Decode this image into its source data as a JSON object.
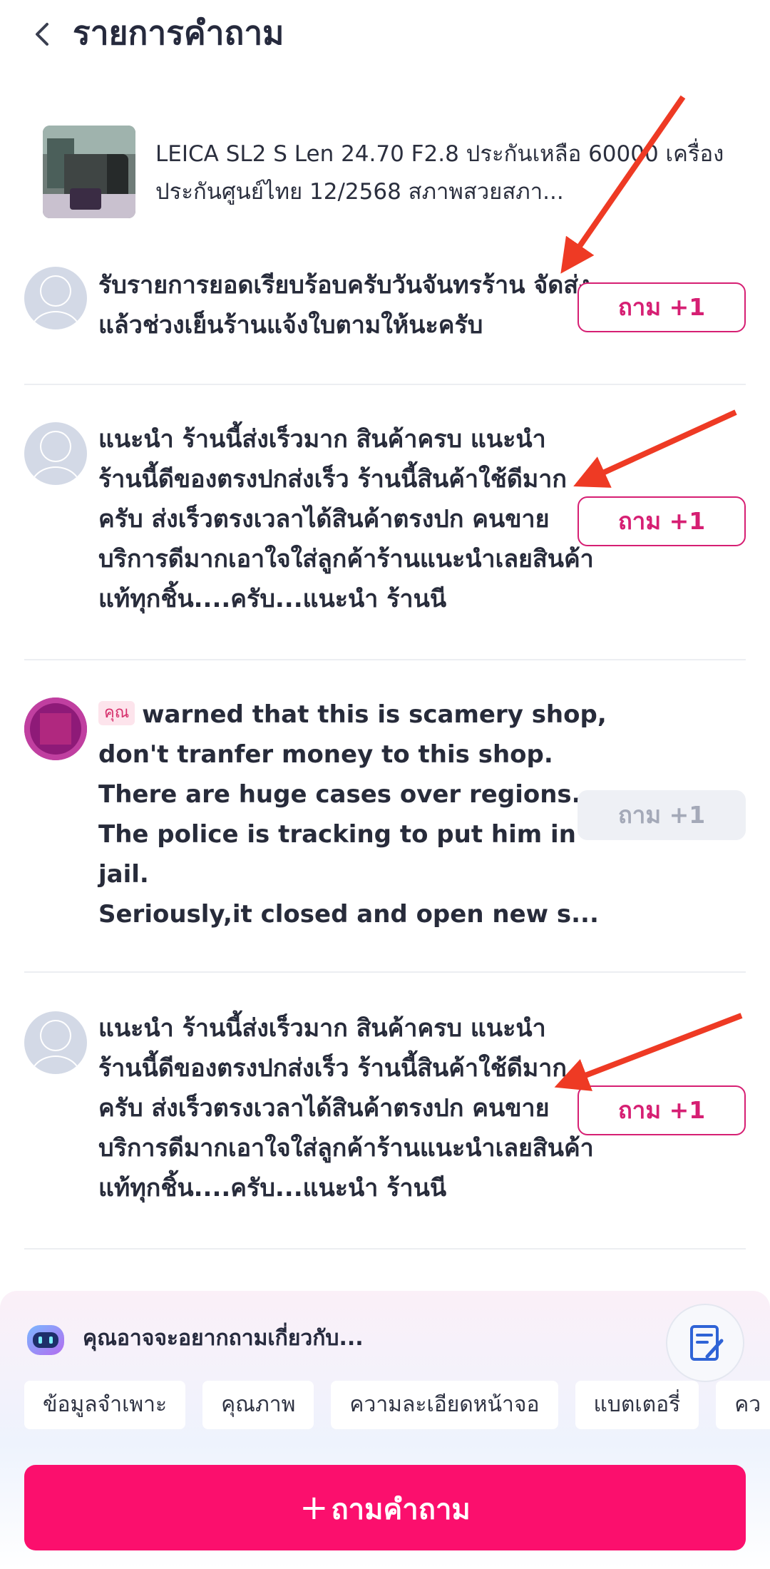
{
  "header": {
    "title": "รายการคำถาม"
  },
  "product": {
    "title": "LEICA SL2 S Len 24.70 F2.8  ประกันเหลือ 60000  เครื่องประกันศูนย์ไทย 12/2568 สภาพสวยสภา..."
  },
  "questions": [
    {
      "text": "รับรายการยอดเรียบร้อบครับวันจันทรร้าน จัดส่งแล้วช่วงเย็นร้านแจ้งใบตามให้นะครับ",
      "ask_label": "ถาม +1"
    },
    {
      "text": "แนะนำ ร้านนี้ส่งเร็วมาก สินค้าครบ แนะนำ ร้านนี้ดีของตรงปกส่งเร็ว ร้านนี้สินค้าใช้ดีมากครับ ส่งเร็วตรงเวลาได้สินค้าตรงปก คนขายบริการดีมากเอาใจใส่ลูกค้าร้านแนะนำเลยสินค้าแท้ทุกชิ้น....ครับ...แนะนำ ร้านนี",
      "ask_label": "ถาม +1"
    },
    {
      "badge": "คุณ",
      "text": "warned that this is scamery shop, don't tranfer money to this shop. There are huge cases over regions. The police is tracking to put him in jail.",
      "text2": "Seriously,it closed and open new s...",
      "ask_label": "ถาม +1"
    },
    {
      "text": "แนะนำ ร้านนี้ส่งเร็วมาก สินค้าครบ แนะนำ ร้านนี้ดีของตรงปกส่งเร็ว ร้านนี้สินค้าใช้ดีมากครับ ส่งเร็วตรงเวลาได้สินค้าตรงปก คนขายบริการดีมากเอาใจใส่ลูกค้าร้านแนะนำเลยสินค้าแท้ทุกชิ้น....ครับ...แนะนำ ร้านนี",
      "ask_label": "ถาม +1"
    }
  ],
  "suggest": {
    "title": "คุณอาจจะอยากถามเกี่ยวกับ...",
    "chips": [
      "ข้อมูลจำเพาะ",
      "คุณภาพ",
      "ความละเอียดหน้าจอ",
      "แบตเตอรี่",
      "คว"
    ]
  },
  "ask_button": {
    "plus": "+",
    "label": "ถามคำถาม"
  },
  "colors": {
    "accent": "#fb0f6d",
    "ask_outline": "#d61f73",
    "arrow": "#ee3a24"
  }
}
